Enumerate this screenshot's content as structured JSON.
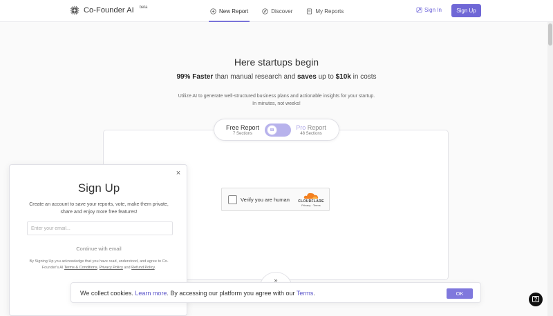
{
  "header": {
    "logo_text": "Co-Founder AI",
    "logo_badge": "beta",
    "nav": [
      {
        "label": "New Report",
        "icon": "plus-circle-icon",
        "active": true
      },
      {
        "label": "Discover",
        "icon": "compass-icon",
        "active": false
      },
      {
        "label": "My Reports",
        "icon": "document-icon",
        "active": false
      }
    ],
    "signin_label": "Sign In",
    "signup_label": "Sign Up"
  },
  "hero": {
    "title": "Here startups begin",
    "sub_strong1": "99% Faster",
    "sub_text1": " than manual research and ",
    "sub_strong2": "saves",
    "sub_text2": " up to ",
    "sub_strong3": "$10k",
    "sub_text3": " in costs",
    "desc_line1": "Utilize AI to generate well-structured business plans and actionable insights for your startup.",
    "desc_line2": "In minutes, not weeks!"
  },
  "report_toggle": {
    "free_name": "Free Report",
    "free_count": "7 Sections",
    "pro_prefix": "Pro",
    "pro_suffix": " Report",
    "pro_count": "48 Sections",
    "knob_label": "99"
  },
  "captcha": {
    "label": "Verify you are human",
    "brand": "CLOUDFLARE",
    "links": "Privacy · Terms"
  },
  "expand_label": "»",
  "modal": {
    "title": "Sign Up",
    "text": "Create an account to save your reports, vote, make them private, share and enjoy more free features!",
    "email_placeholder": "Enter your email...",
    "continue_label": "Continue with email",
    "legal_prefix": "By Signing Up you acknowledge that you have read, understood, and agree to Co-Founder's AI ",
    "terms_link": "Terms & Conditions",
    "legal_sep": ", ",
    "privacy_link": "Privacy Policy",
    "legal_and": " and ",
    "refund_link": "Refund Policy",
    "legal_end": ".",
    "close_label": "×"
  },
  "cookie": {
    "text1": "We collect cookies. ",
    "learn_more": "Learn more",
    "text2": ". By accessing our platform you agree with our ",
    "terms": "Terms",
    "text3": ".",
    "ok_label": "OK"
  },
  "colors": {
    "accent": "#6f67d6",
    "accent_light": "#b7b2ec",
    "help_button": "#111111"
  }
}
